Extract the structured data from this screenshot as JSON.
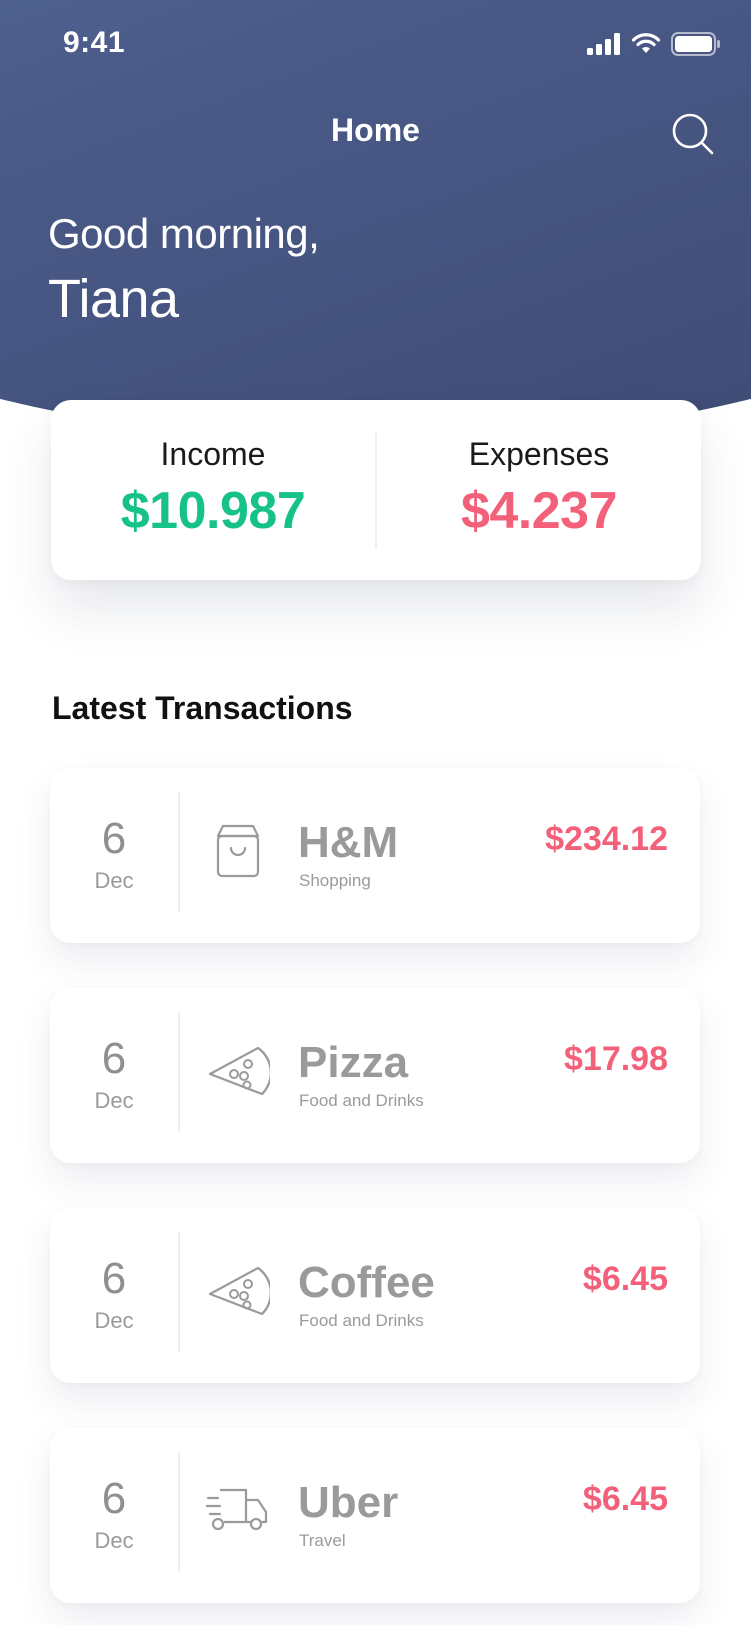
{
  "status_bar": {
    "time": "9:41",
    "icons": [
      "cellular-signal-icon",
      "wifi-icon",
      "battery-icon"
    ]
  },
  "nav": {
    "title": "Home",
    "search_icon": "search-icon"
  },
  "greeting": {
    "line1": "Good morning,",
    "name": "Tiana"
  },
  "summary": {
    "income_label": "Income",
    "income_value": "$10.987",
    "expenses_label": "Expenses",
    "expenses_value": "$4.237"
  },
  "colors": {
    "header_gradient_start": "#5b71a0",
    "header_gradient_end": "#3e4a73",
    "income": "#17c28a",
    "expense": "#f3607a",
    "muted_text": "#9a9a9a"
  },
  "transactions_section": {
    "title": "Latest Transactions",
    "items": [
      {
        "day": "6",
        "month": "Dec",
        "icon": "shopping-bag-icon",
        "name": "H&M",
        "category": "Shopping",
        "amount": "$234.12"
      },
      {
        "day": "6",
        "month": "Dec",
        "icon": "pizza-slice-icon",
        "name": "Pizza",
        "category": "Food and Drinks",
        "amount": "$17.98"
      },
      {
        "day": "6",
        "month": "Dec",
        "icon": "pizza-slice-icon",
        "name": "Coffee",
        "category": "Food and Drinks",
        "amount": "$6.45"
      },
      {
        "day": "6",
        "month": "Dec",
        "icon": "delivery-truck-icon",
        "name": "Uber",
        "category": "Travel",
        "amount": "$6.45"
      }
    ]
  }
}
